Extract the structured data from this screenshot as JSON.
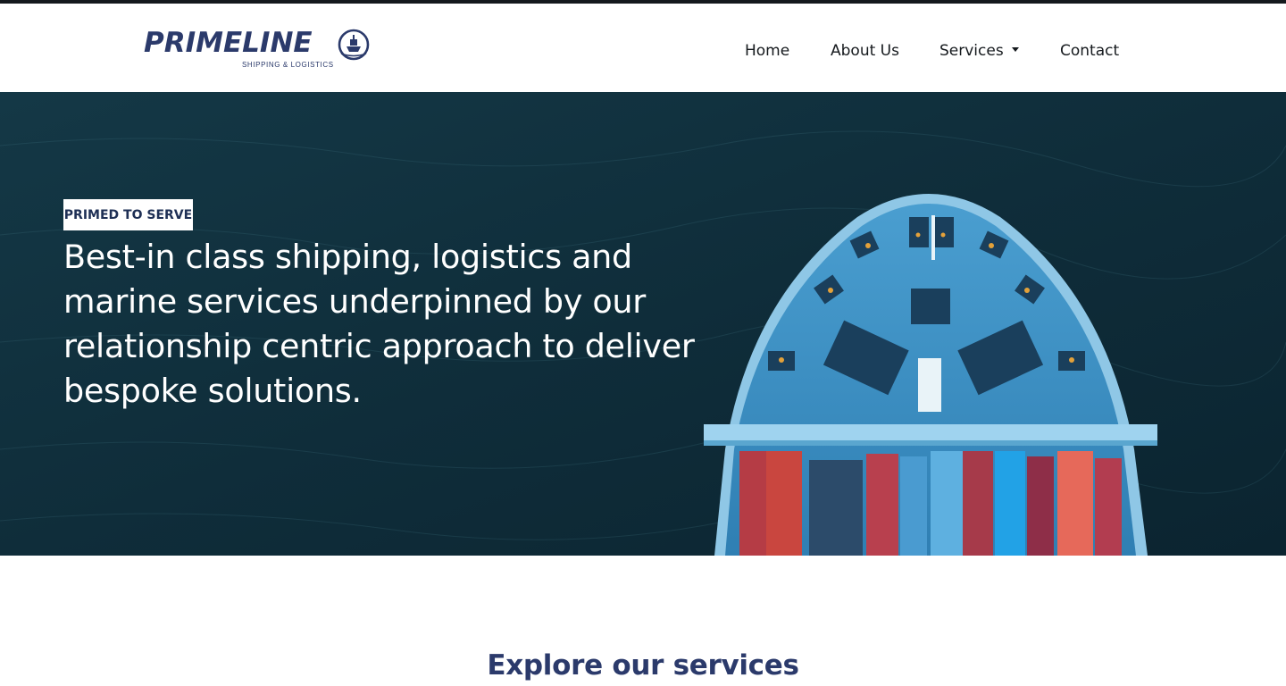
{
  "brand": {
    "name": "PRIMELINE",
    "tagline": "SHIPPING & LOGISTICS",
    "colors": {
      "navy": "#2b3a6b",
      "text": "#15191d",
      "hero_bg": "#0f2a35"
    },
    "logo_icon": "ship-circle-icon"
  },
  "nav": {
    "items": [
      {
        "label": "Home"
      },
      {
        "label": "About Us"
      },
      {
        "label": "Services",
        "has_dropdown": true,
        "icon": "caret-down-icon"
      },
      {
        "label": "Contact"
      }
    ]
  },
  "hero": {
    "badge": "PRIMED TO SERVE",
    "headline": "Best-in class shipping, logistics and marine services underpinned by our relationship centric approach to deliver bespoke solutions.",
    "image": "aerial-cargo-ship-image"
  },
  "services": {
    "heading": "Explore our services"
  }
}
